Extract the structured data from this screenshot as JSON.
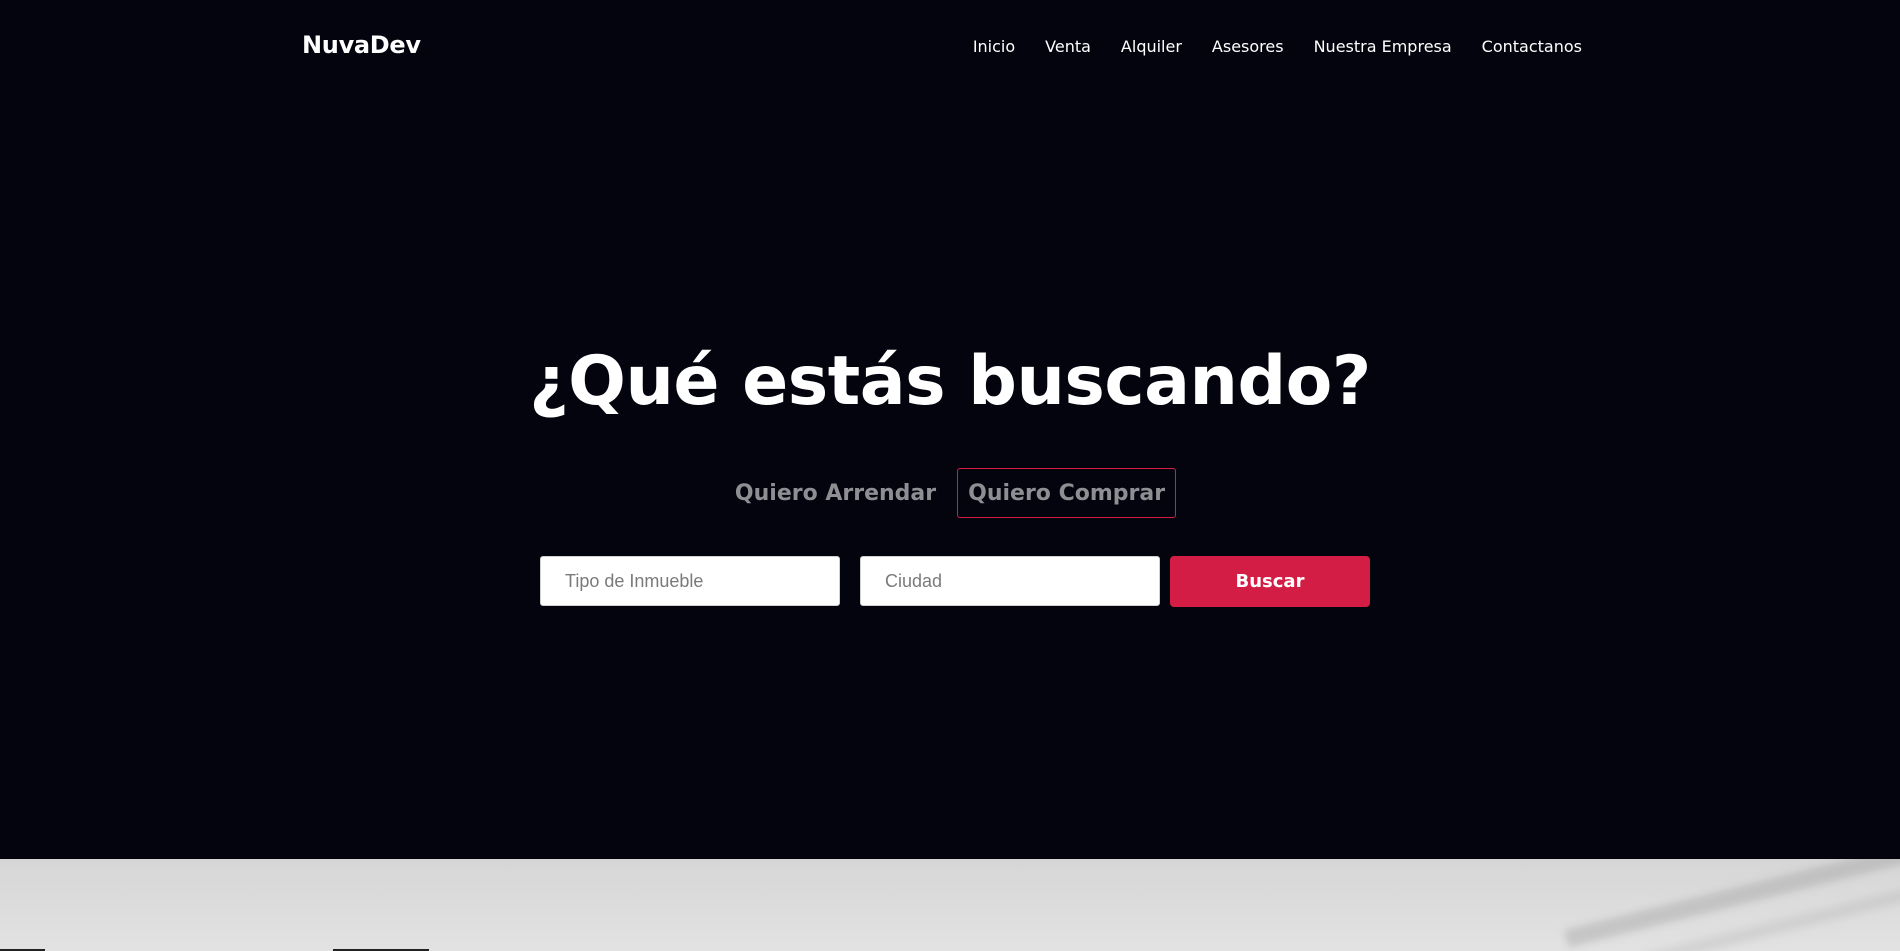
{
  "brand": "NuvaDev",
  "nav": {
    "items": [
      "Inicio",
      "Venta",
      "Alquiler",
      "Asesores",
      "Nuestra Empresa",
      "Contactanos"
    ]
  },
  "hero": {
    "title": "¿Qué estás buscando?",
    "tabs": [
      {
        "label": "Quiero Arrendar",
        "active": false
      },
      {
        "label": "Quiero Comprar",
        "active": true
      }
    ]
  },
  "search": {
    "tipo_placeholder": "Tipo de Inmueble",
    "tipo_value": "",
    "ciudad_placeholder": "Ciudad",
    "ciudad_value": "",
    "button_label": "Buscar"
  },
  "colors": {
    "background": "#04040f",
    "accent": "#d31d45",
    "text": "#ffffff",
    "muted": "#8e8e93"
  }
}
